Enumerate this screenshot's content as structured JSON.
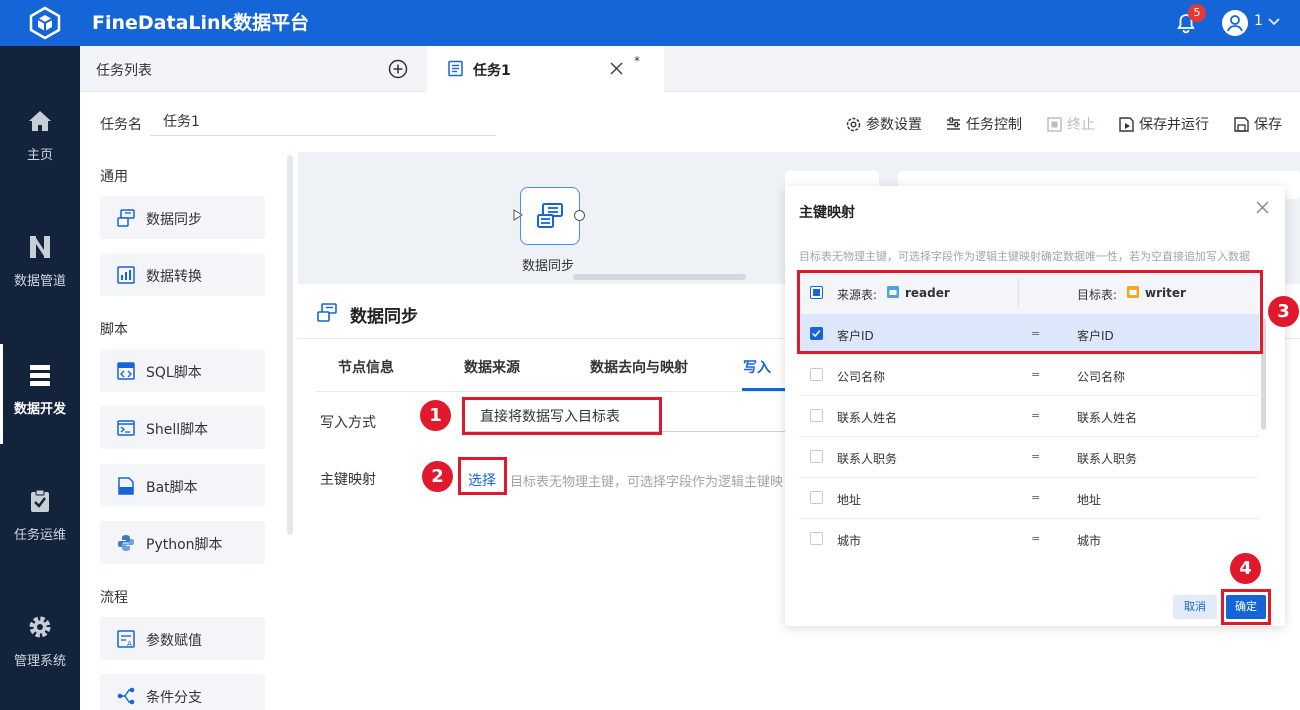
{
  "app": {
    "title": "FineDataLink数据平台",
    "notification_count": "5",
    "user_name": "1"
  },
  "sidebar": {
    "items": [
      {
        "label": "主页",
        "icon": "home-icon"
      },
      {
        "label": "数据管道",
        "icon": "pipeline-icon"
      },
      {
        "label": "数据开发",
        "icon": "dev-icon",
        "active": true
      },
      {
        "label": "任务运维",
        "icon": "clipboard-check-icon"
      },
      {
        "label": "管理系统",
        "icon": "gear-icon"
      }
    ]
  },
  "tabs": {
    "list_label": "任务列表",
    "active_tab": "任务1",
    "modified_mark": "*"
  },
  "task": {
    "name_label": "任务名",
    "name_value": "任务1"
  },
  "toolbar": {
    "params": "参数设置",
    "control": "任务控制",
    "stop": "终止",
    "save_run": "保存并运行",
    "save": "保存"
  },
  "palette": {
    "general_heading": "通用",
    "general": [
      "数据同步",
      "数据转换"
    ],
    "script_heading": "脚本",
    "scripts": [
      "SQL脚本",
      "Shell脚本",
      "Bat脚本",
      "Python脚本"
    ],
    "flow_heading": "流程",
    "flow": [
      "参数赋值",
      "条件分支"
    ]
  },
  "canvas": {
    "node_label": "数据同步"
  },
  "panel": {
    "title": "数据同步",
    "tabs": [
      "节点信息",
      "数据来源",
      "数据去向与映射",
      "写入"
    ],
    "write_mode_label": "写入方式",
    "write_mode_value": "直接将数据写入目标表",
    "pk_label": "主键映射",
    "pk_select": "选择",
    "pk_hint": "目标表无物理主键，可选择字段作为逻辑主键映"
  },
  "modal": {
    "title": "主键映射",
    "hint": "目标表无物理主键，可选择字段作为逻辑主键映射确定数据唯一性，若为空直接追加写入数据",
    "source_label": "来源表:",
    "source_name": "reader",
    "target_label": "目标表:",
    "target_name": "writer",
    "rows": [
      {
        "source": "客户ID",
        "eq": "=",
        "target": "客户ID",
        "checked": true
      },
      {
        "source": "公司名称",
        "eq": "=",
        "target": "公司名称",
        "checked": false
      },
      {
        "source": "联系人姓名",
        "eq": "=",
        "target": "联系人姓名",
        "checked": false
      },
      {
        "source": "联系人职务",
        "eq": "=",
        "target": "联系人职务",
        "checked": false
      },
      {
        "source": "地址",
        "eq": "=",
        "target": "地址",
        "checked": false
      },
      {
        "source": "城市",
        "eq": "=",
        "target": "城市",
        "checked": false
      }
    ],
    "cancel": "取消",
    "ok": "确定"
  },
  "annotations": [
    "1",
    "2",
    "3",
    "4"
  ],
  "colors": {
    "brand": "#1565d8",
    "sidebar": "#14233c",
    "highlight": "#e0192c"
  }
}
